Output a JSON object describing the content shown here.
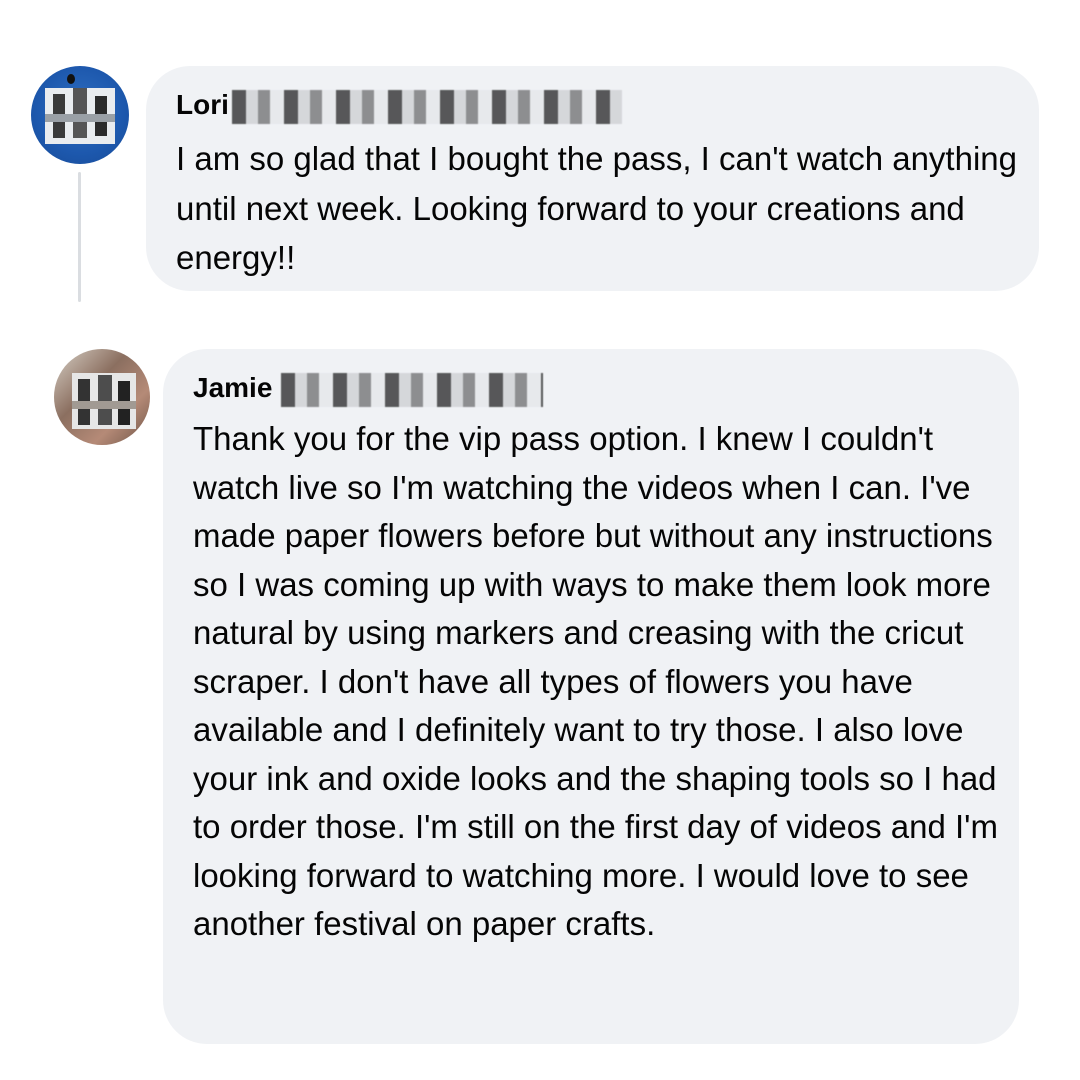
{
  "comments": [
    {
      "author": "Lori",
      "text": "I am so glad that I bought the pass, I can't watch anything until next week.  Looking forward to your creations and energy!!"
    },
    {
      "author": "Jamie",
      "text": "Thank you for the vip pass option. I knew I couldn't watch live so I'm watching the videos when I can. I've made paper flowers before but without any instructions so I was coming up with ways to make them look more natural by using markers and creasing with the cricut scraper. I don't have all types of flowers you have available and I definitely want to try those. I also love your ink and oxide looks and the shaping tools so I had to order those. I'm still on the first day of videos and I'm looking forward to watching more. I would love to see another festival on paper crafts."
    }
  ],
  "colors": {
    "bubble": "#f0f2f5",
    "text": "#050505",
    "thread_line": "#dadde1"
  }
}
